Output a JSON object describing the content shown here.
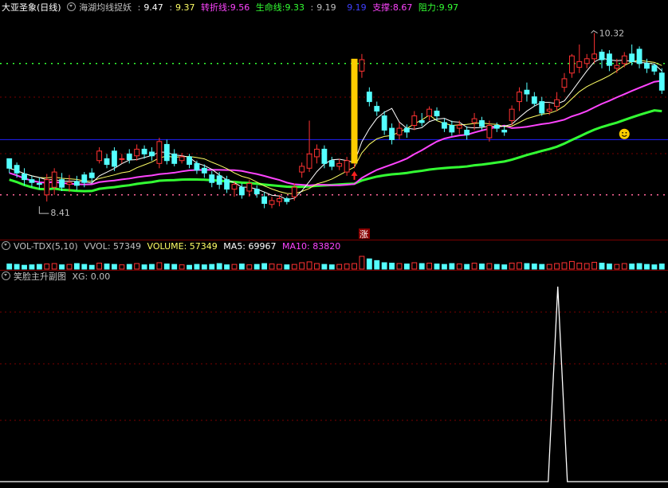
{
  "main": {
    "title": "大亚圣象(日线)",
    "indicator": "海湖均线捉妖",
    "v1": "9.47",
    "v2": "9.37",
    "zhezhe_label": "转折线:",
    "zhezhe_val": "9.56",
    "life_label": "生命线:",
    "life_val": "9.33",
    "v3": "9.19",
    "v4": "9.19",
    "support_label": "支撑:",
    "support_val": "8.67",
    "resist_label": "阻力:",
    "resist_val": "9.97",
    "high_label": "10.32",
    "low_label": "8.41",
    "zhang_label": "涨"
  },
  "vol": {
    "title": "VOL-TDX(5,10)",
    "vvol": "VVOL: 57349",
    "volume": "VOLUME: 57349",
    "ma5": "MA5: 69967",
    "ma10": "MA10: 83820"
  },
  "sub": {
    "title": "笑脸主升副图",
    "xg": "XG: 0.00"
  },
  "colors": {
    "up": "#ff3232",
    "down": "#54ffff",
    "bg": "#000000",
    "ma_white": "#ffffff",
    "ma_yellow": "#ffff66",
    "ma_magenta": "#ff44ff",
    "ma_green": "#33ff33",
    "hline_blue": "#2020ff",
    "signal_bar": "#ffcc00"
  },
  "chart_data": {
    "type": "candlestick",
    "ylim": [
      8.2,
      10.5
    ],
    "lines_price": {
      "green_dotted": 10.0,
      "blue": 9.2,
      "pink_dotted": 8.62
    },
    "candles": [
      [
        9.0,
        8.9,
        8.85,
        8.98
      ],
      [
        8.93,
        8.85,
        8.8,
        8.96
      ],
      [
        8.84,
        8.78,
        8.72,
        8.9
      ],
      [
        8.78,
        8.75,
        8.7,
        8.82
      ],
      [
        8.74,
        8.73,
        8.68,
        8.8
      ],
      [
        8.62,
        8.78,
        8.55,
        8.84
      ],
      [
        8.7,
        8.86,
        8.62,
        8.9
      ],
      [
        8.78,
        8.7,
        8.66,
        8.85
      ],
      [
        8.73,
        8.75,
        8.65,
        8.83
      ],
      [
        8.76,
        8.72,
        8.67,
        8.82
      ],
      [
        8.83,
        8.75,
        8.7,
        8.86
      ],
      [
        8.85,
        8.8,
        8.75,
        8.9
      ],
      [
        8.98,
        9.08,
        8.95,
        9.12
      ],
      [
        9.0,
        8.94,
        8.9,
        9.05
      ],
      [
        9.08,
        8.92,
        8.87,
        9.12
      ],
      [
        9.0,
        9.0,
        8.95,
        9.05
      ],
      [
        9.05,
        8.99,
        8.95,
        9.1
      ],
      [
        9.03,
        9.1,
        8.98,
        9.15
      ],
      [
        9.1,
        9.05,
        9.0,
        9.14
      ],
      [
        9.07,
        9.03,
        8.98,
        9.12
      ],
      [
        8.95,
        9.18,
        8.9,
        9.22
      ],
      [
        9.15,
        8.98,
        8.94,
        9.2
      ],
      [
        9.05,
        8.95,
        8.92,
        9.1
      ],
      [
        8.98,
        9.02,
        8.95,
        9.06
      ],
      [
        9.02,
        8.94,
        8.9,
        9.05
      ],
      [
        8.95,
        8.88,
        8.84,
        8.98
      ],
      [
        8.9,
        8.85,
        8.8,
        8.94
      ],
      [
        8.83,
        8.75,
        8.7,
        8.87
      ],
      [
        8.82,
        8.73,
        8.68,
        8.86
      ],
      [
        8.78,
        8.68,
        8.64,
        8.82
      ],
      [
        8.68,
        8.73,
        8.6,
        8.76
      ],
      [
        8.7,
        8.62,
        8.58,
        8.74
      ],
      [
        8.66,
        8.74,
        8.6,
        8.78
      ],
      [
        8.68,
        8.63,
        8.59,
        8.72
      ],
      [
        8.6,
        8.53,
        8.48,
        8.65
      ],
      [
        8.52,
        8.56,
        8.48,
        8.6
      ],
      [
        8.55,
        8.58,
        8.5,
        8.62
      ],
      [
        8.58,
        8.55,
        8.52,
        8.6
      ],
      [
        8.6,
        8.7,
        8.56,
        8.74
      ],
      [
        8.86,
        8.92,
        8.8,
        8.96
      ],
      [
        8.9,
        9.05,
        8.86,
        9.4
      ],
      [
        9.02,
        9.1,
        8.95,
        9.15
      ],
      [
        9.1,
        8.95,
        8.9,
        9.14
      ],
      [
        8.98,
        8.92,
        8.88,
        9.02
      ],
      [
        8.92,
        8.95,
        8.88,
        9.0
      ],
      [
        8.86,
        8.98,
        8.82,
        9.02
      ],
      [
        8.98,
        9.0,
        8.9,
        9.05
      ],
      [
        9.92,
        10.04,
        9.85,
        10.1
      ],
      [
        9.7,
        9.6,
        9.55,
        9.75
      ],
      [
        9.55,
        9.5,
        9.45,
        9.6
      ],
      [
        9.45,
        9.3,
        9.25,
        9.5
      ],
      [
        9.32,
        9.2,
        9.15,
        9.37
      ],
      [
        9.25,
        9.32,
        9.2,
        9.38
      ],
      [
        9.32,
        9.28,
        9.22,
        9.36
      ],
      [
        9.35,
        9.45,
        9.3,
        9.5
      ],
      [
        9.4,
        9.38,
        9.34,
        9.48
      ],
      [
        9.45,
        9.52,
        9.4,
        9.55
      ],
      [
        9.5,
        9.45,
        9.4,
        9.54
      ],
      [
        9.38,
        9.32,
        9.28,
        9.42
      ],
      [
        9.35,
        9.28,
        9.24,
        9.4
      ],
      [
        9.32,
        9.35,
        9.26,
        9.4
      ],
      [
        9.3,
        9.25,
        9.2,
        9.34
      ],
      [
        9.38,
        9.42,
        9.3,
        9.48
      ],
      [
        9.4,
        9.34,
        9.3,
        9.44
      ],
      [
        9.22,
        9.35,
        9.18,
        9.4
      ],
      [
        9.35,
        9.32,
        9.28,
        9.38
      ],
      [
        9.3,
        9.28,
        9.24,
        9.34
      ],
      [
        9.4,
        9.52,
        9.35,
        9.56
      ],
      [
        9.6,
        9.7,
        9.5,
        9.75
      ],
      [
        9.72,
        9.68,
        9.6,
        9.8
      ],
      [
        9.65,
        9.58,
        9.55,
        9.7
      ],
      [
        9.6,
        9.48,
        9.45,
        9.65
      ],
      [
        9.5,
        9.52,
        9.46,
        9.58
      ],
      [
        9.55,
        9.62,
        9.5,
        9.7
      ],
      [
        9.75,
        9.84,
        9.7,
        9.9
      ],
      [
        9.9,
        10.08,
        9.85,
        10.1
      ],
      [
        9.96,
        10.02,
        9.9,
        10.2
      ],
      [
        10.0,
        10.05,
        9.95,
        10.1
      ],
      [
        10.05,
        10.1,
        10.0,
        10.32
      ],
      [
        10.12,
        10.04,
        9.95,
        10.15
      ],
      [
        10.1,
        9.98,
        9.92,
        10.14
      ],
      [
        9.95,
        9.98,
        9.9,
        10.05
      ],
      [
        10.0,
        10.08,
        9.96,
        10.12
      ],
      [
        10.1,
        10.02,
        9.98,
        10.2
      ],
      [
        10.15,
        10.0,
        9.95,
        10.18
      ],
      [
        10.0,
        9.95,
        9.9,
        10.05
      ],
      [
        9.98,
        9.92,
        9.88,
        10.0
      ],
      [
        9.9,
        9.72,
        9.68,
        9.95
      ]
    ],
    "vol_series": [
      24,
      22,
      18,
      20,
      22,
      24,
      26,
      20,
      22,
      26,
      22,
      18,
      28,
      24,
      22,
      20,
      22,
      26,
      20,
      22,
      30,
      24,
      22,
      20,
      18,
      22,
      20,
      22,
      26,
      20,
      22,
      24,
      20,
      22,
      26,
      24,
      22,
      20,
      22,
      30,
      34,
      26,
      22,
      20,
      22,
      24,
      26,
      60,
      48,
      40,
      30,
      28,
      26,
      24,
      30,
      26,
      28,
      24,
      22,
      26,
      24,
      22,
      28,
      24,
      26,
      22,
      20,
      28,
      30,
      26,
      24,
      22,
      22,
      26,
      30,
      36,
      28,
      26,
      32,
      28,
      24,
      22,
      26,
      24,
      26,
      22,
      20,
      24
    ],
    "xg_peak_index": 0.835
  }
}
